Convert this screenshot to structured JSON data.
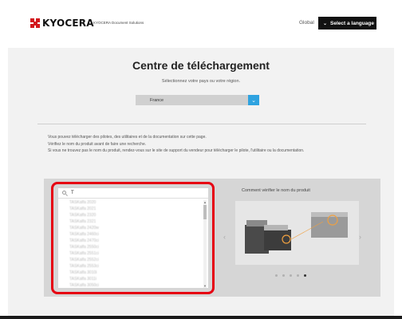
{
  "header": {
    "brand": "KYOCERA",
    "tagline": "KYOCERA Document Solutions",
    "global_link": "Global",
    "language_button": "Select a language"
  },
  "main": {
    "title": "Centre de téléchargement",
    "subtitle": "Sélectionnez votre pays ou votre région.",
    "country_select": {
      "value": "France"
    },
    "info_lines": [
      "Vous pouvez télécharger des pilotes, des utilitaires et de la documentation sur cette page.",
      "Vérifiez le nom du produit avant de faire une recherche.",
      "Si vous ne trouvez pas le nom du produit, rendez-vous sur le site de support du vendeur pour télécharger le pilote, l'utilitaire ou la documentation."
    ]
  },
  "search": {
    "value": "T",
    "results": [
      "TASKalfa 2020",
      "TASKalfa 2021",
      "TASKalfa 2320",
      "TASKalfa 2321",
      "TASKalfa 2420w",
      "TASKalfa 2460ci",
      "TASKalfa 2470ci",
      "TASKalfa 2550ci",
      "TASKalfa 2551ci",
      "TASKalfa 2552ci",
      "TASKalfa 2553ci",
      "TASKalfa 3010i",
      "TASKalfa 3011i",
      "TASKalfa 3050ci",
      "TASKalfa 3051ci"
    ]
  },
  "carousel": {
    "title": "Comment vérifier le nom du produit",
    "total_slides": 5,
    "active_slide": 5
  },
  "colors": {
    "brand_red": "#d2191e",
    "highlight_red": "#e60012",
    "accent_blue": "#2fa3e0"
  }
}
